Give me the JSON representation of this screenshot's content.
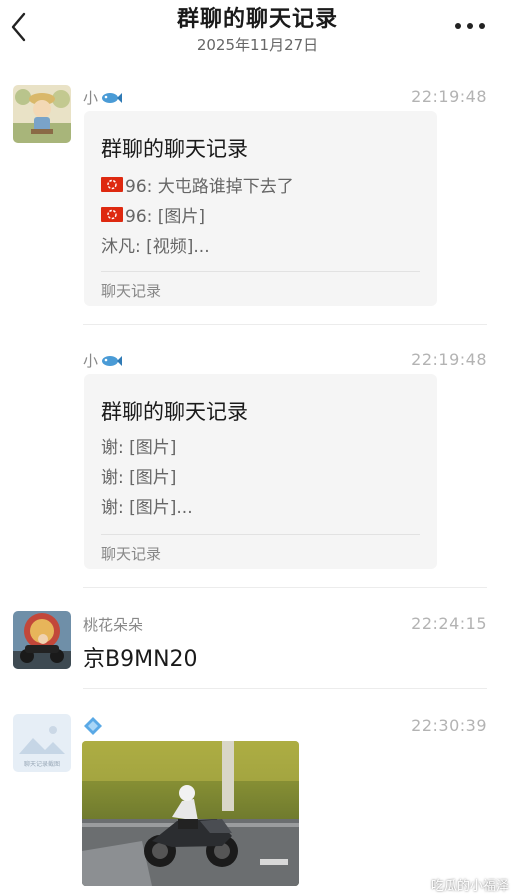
{
  "header": {
    "title": "群聊的聊天记录",
    "date": "2025年11月27日"
  },
  "messages": [
    {
      "sender": "小",
      "time": "22:19:48",
      "card": {
        "title": "群聊的聊天记录",
        "lines": [
          "96: 大屯路谁掉下去了",
          "96: [图片]",
          "沐凡: [视频]..."
        ],
        "footer": "聊天记录"
      }
    },
    {
      "sender": "小",
      "time": "22:19:48",
      "card": {
        "title": "群聊的聊天记录",
        "lines": [
          "谢: [图片]",
          "谢: [图片]",
          "谢: [图片]..."
        ],
        "footer": "聊天记录"
      }
    },
    {
      "sender": "桃花朵朵",
      "time": "22:24:15",
      "text": "京B9MN20"
    },
    {
      "sender": "",
      "time": "22:30:39",
      "avatar_text": "聊天记录截图"
    }
  ],
  "watermark": "吃瓜的小福泽",
  "icons": {
    "back": "chevron-left-icon",
    "more": "more-dots-icon",
    "fish": "fish-icon",
    "flag": "hong-kong-flag-icon",
    "diamond": "diamond-icon"
  },
  "colors": {
    "card_bg": "#f5f5f5",
    "time": "#b3b3b3",
    "sender": "#888888"
  }
}
